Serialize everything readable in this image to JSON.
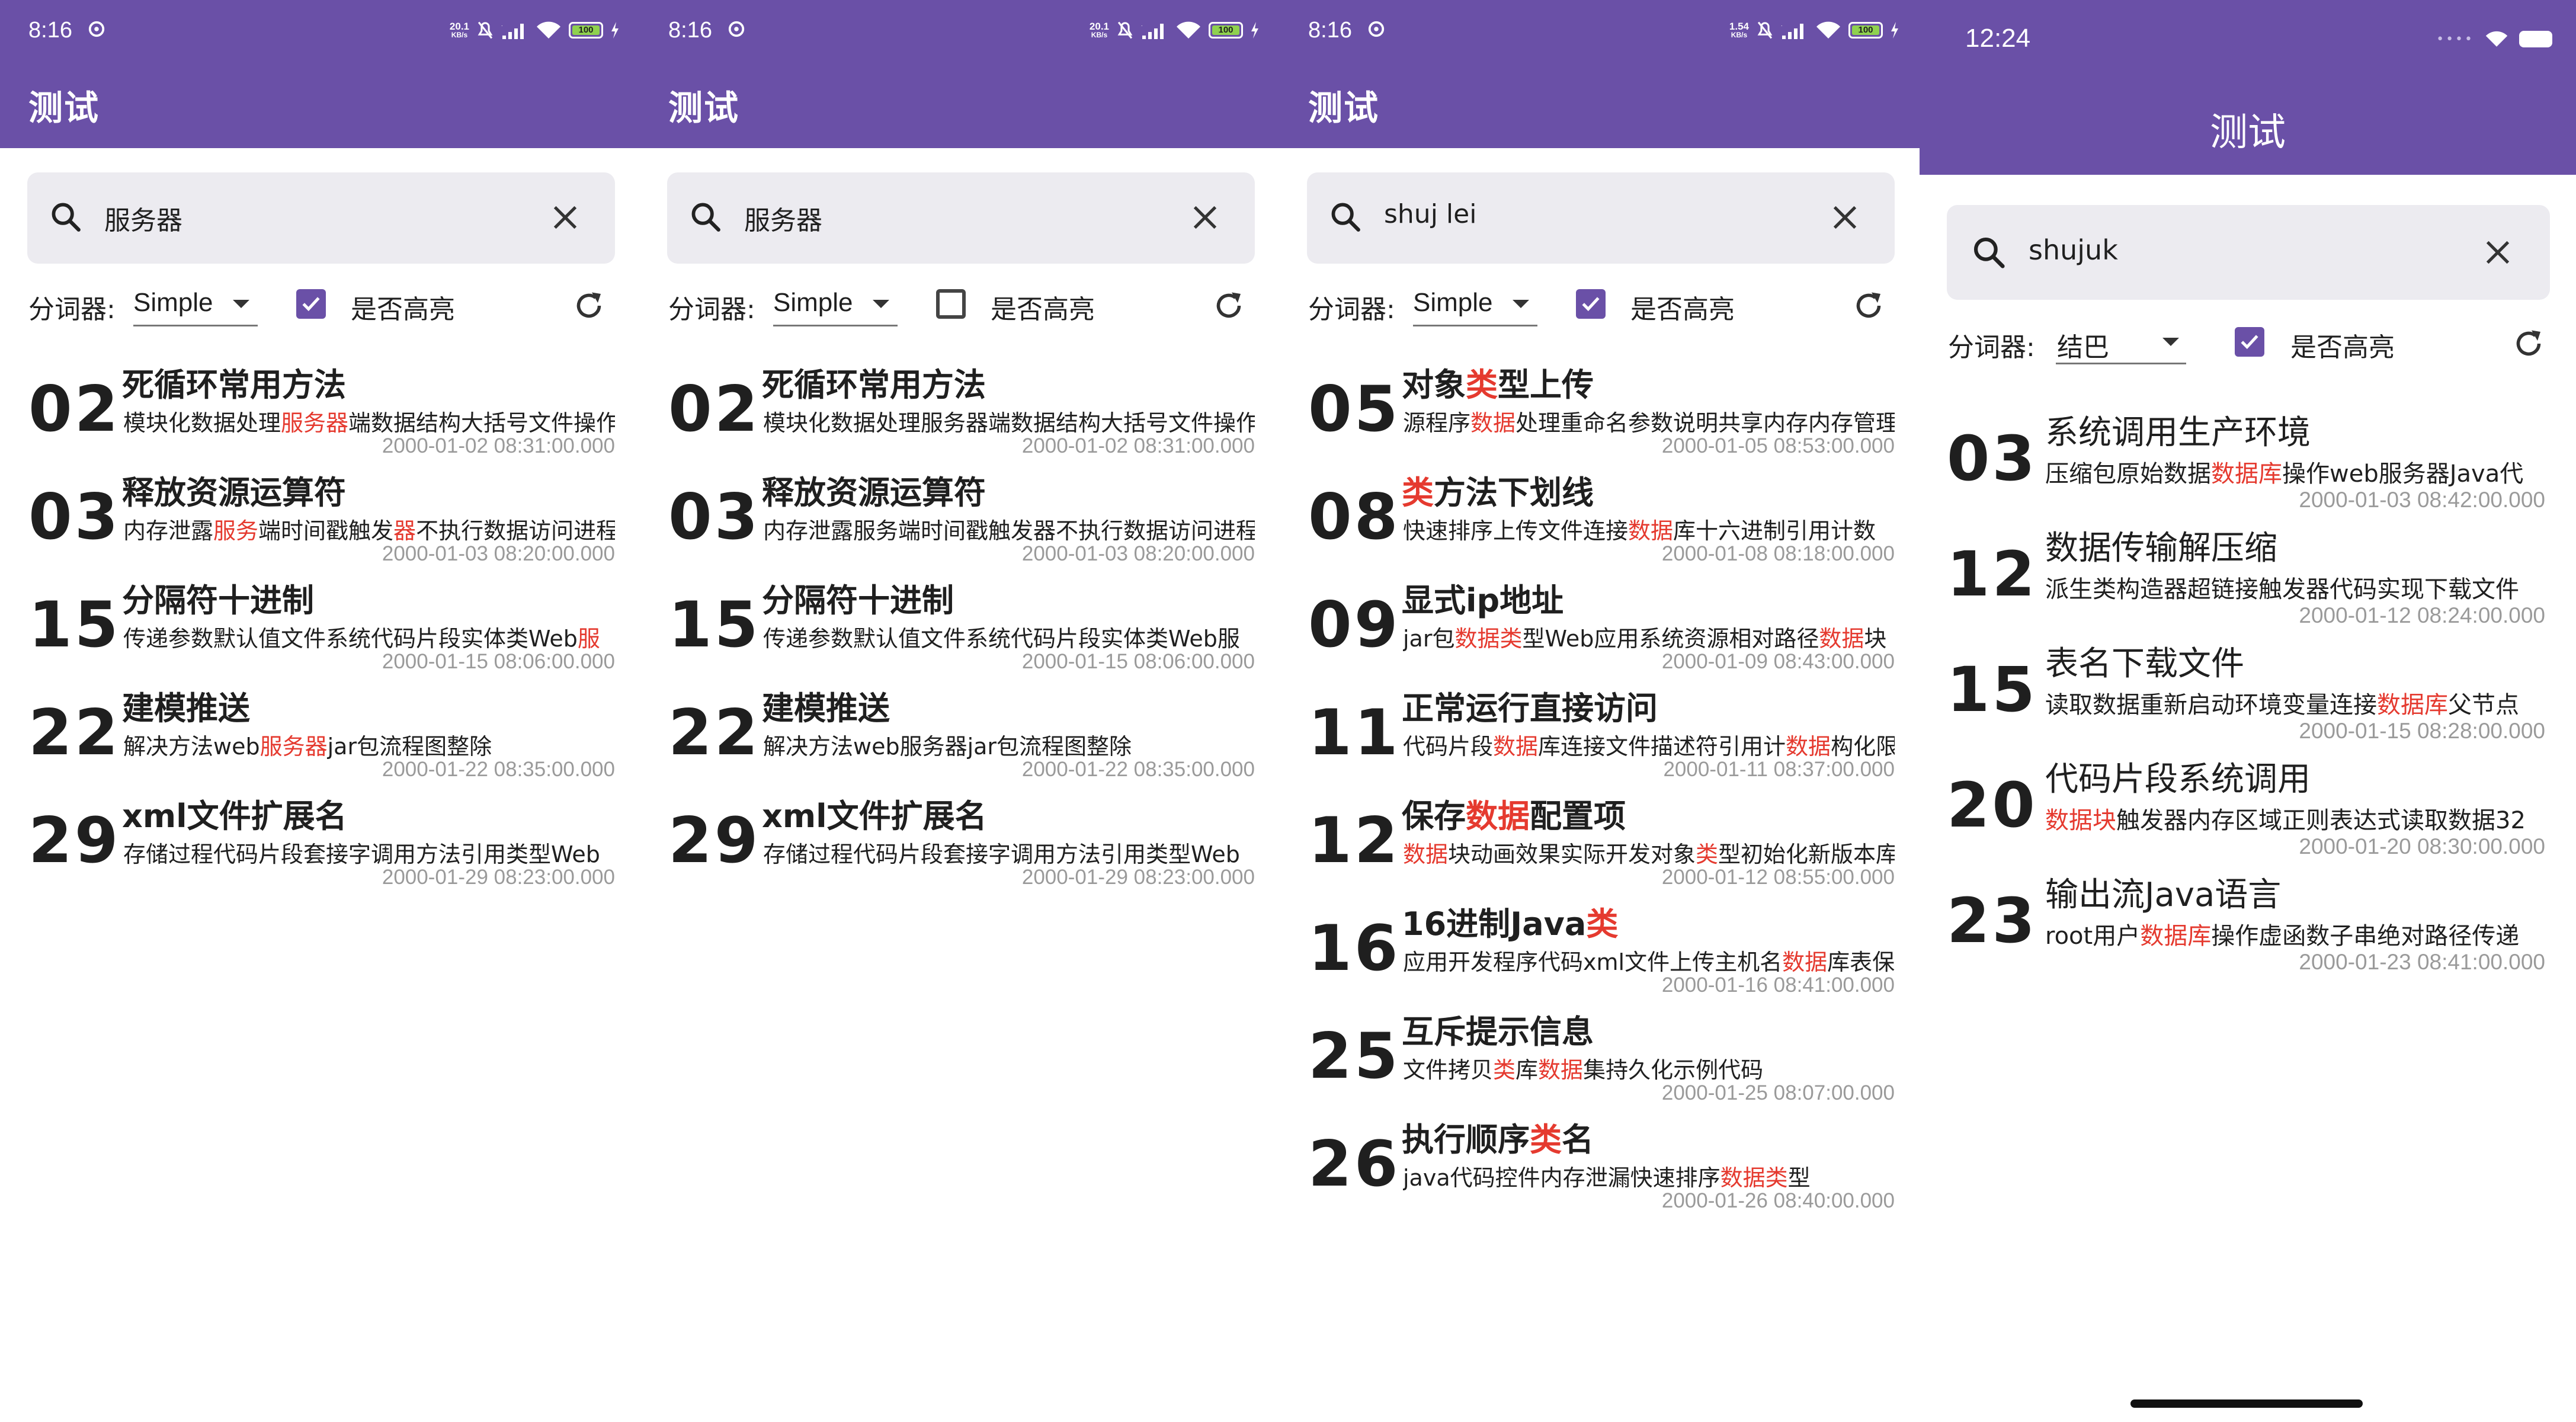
{
  "screens": [
    {
      "status": {
        "time": "8:16",
        "speed": "20.1",
        "speed_unit": "KB/s",
        "battery": "100"
      },
      "title": "测试",
      "search": {
        "value": "服务器"
      },
      "tokenizer_label": "分词器:",
      "tokenizer_value": "Simple",
      "highlight_label": "是否高亮",
      "highlight_checked": true,
      "items": [
        {
          "num": "02",
          "title": [
            {
              "t": "死循环常用方法"
            }
          ],
          "desc": [
            {
              "t": "模块化数据处理"
            },
            {
              "t": "服务器",
              "h": true
            },
            {
              "t": "端数据结构大括号文件操作"
            }
          ],
          "date": "2000-01-02 08:31:00.000"
        },
        {
          "num": "03",
          "title": [
            {
              "t": "释放资源运算符"
            }
          ],
          "desc": [
            {
              "t": "内存泄露"
            },
            {
              "t": "服务",
              "h": true
            },
            {
              "t": "端时间戳触发"
            },
            {
              "t": "器",
              "h": true
            },
            {
              "t": "不执行数据访问进程"
            }
          ],
          "date": "2000-01-03 08:20:00.000"
        },
        {
          "num": "15",
          "title": [
            {
              "t": "分隔符十进制"
            }
          ],
          "desc": [
            {
              "t": "传递参数默认值文件系统代码片段实体类Web"
            },
            {
              "t": "服",
              "h": true
            }
          ],
          "date": "2000-01-15 08:06:00.000"
        },
        {
          "num": "22",
          "title": [
            {
              "t": "建模推送"
            }
          ],
          "desc": [
            {
              "t": "解决方法web"
            },
            {
              "t": "服务器",
              "h": true
            },
            {
              "t": "jar包流程图整除"
            }
          ],
          "date": "2000-01-22 08:35:00.000"
        },
        {
          "num": "29",
          "title": [
            {
              "t": "xml文件扩展名"
            }
          ],
          "desc": [
            {
              "t": "存储过程代码片段套接字调用方法引用类型Web"
            }
          ],
          "date": "2000-01-29 08:23:00.000"
        }
      ]
    },
    {
      "status": {
        "time": "8:16",
        "speed": "20.1",
        "speed_unit": "KB/s",
        "battery": "100"
      },
      "title": "测试",
      "search": {
        "value": "服务器"
      },
      "tokenizer_label": "分词器:",
      "tokenizer_value": "Simple",
      "highlight_label": "是否高亮",
      "highlight_checked": false,
      "items": [
        {
          "num": "02",
          "title": [
            {
              "t": "死循环常用方法"
            }
          ],
          "desc": [
            {
              "t": "模块化数据处理服务器端数据结构大括号文件操作"
            }
          ],
          "date": "2000-01-02 08:31:00.000"
        },
        {
          "num": "03",
          "title": [
            {
              "t": "释放资源运算符"
            }
          ],
          "desc": [
            {
              "t": "内存泄露服务端时间戳触发器不执行数据访问进程"
            }
          ],
          "date": "2000-01-03 08:20:00.000"
        },
        {
          "num": "15",
          "title": [
            {
              "t": "分隔符十进制"
            }
          ],
          "desc": [
            {
              "t": "传递参数默认值文件系统代码片段实体类Web服"
            }
          ],
          "date": "2000-01-15 08:06:00.000"
        },
        {
          "num": "22",
          "title": [
            {
              "t": "建模推送"
            }
          ],
          "desc": [
            {
              "t": "解决方法web服务器jar包流程图整除"
            }
          ],
          "date": "2000-01-22 08:35:00.000"
        },
        {
          "num": "29",
          "title": [
            {
              "t": "xml文件扩展名"
            }
          ],
          "desc": [
            {
              "t": "存储过程代码片段套接字调用方法引用类型Web"
            }
          ],
          "date": "2000-01-29 08:23:00.000"
        }
      ]
    },
    {
      "status": {
        "time": "8:16",
        "speed": "1.54",
        "speed_unit": "KB/s",
        "battery": "100"
      },
      "title": "测试",
      "search": {
        "value": "shuj lei"
      },
      "tokenizer_label": "分词器:",
      "tokenizer_value": "Simple",
      "highlight_label": "是否高亮",
      "highlight_checked": true,
      "items": [
        {
          "num": "05",
          "title": [
            {
              "t": "对象"
            },
            {
              "t": "类",
              "h": true
            },
            {
              "t": "型上传"
            }
          ],
          "desc": [
            {
              "t": "源程序"
            },
            {
              "t": "数据",
              "h": true
            },
            {
              "t": "处理重命名参数说明共享内存内存管理"
            }
          ],
          "date": "2000-01-05 08:53:00.000"
        },
        {
          "num": "08",
          "title": [
            {
              "t": "类",
              "h": true
            },
            {
              "t": "方法下划线"
            }
          ],
          "desc": [
            {
              "t": "快速排序上传文件连接"
            },
            {
              "t": "数据",
              "h": true
            },
            {
              "t": "库十六进制引用计数"
            }
          ],
          "date": "2000-01-08 08:18:00.000"
        },
        {
          "num": "09",
          "title": [
            {
              "t": "显式ip地址"
            }
          ],
          "desc": [
            {
              "t": "jar包"
            },
            {
              "t": "数据类",
              "h": true
            },
            {
              "t": "型Web应用系统资源相对路径"
            },
            {
              "t": "数据",
              "h": true
            },
            {
              "t": "块"
            }
          ],
          "date": "2000-01-09 08:43:00.000"
        },
        {
          "num": "11",
          "title": [
            {
              "t": "正常运行直接访问"
            }
          ],
          "desc": [
            {
              "t": "代码片段"
            },
            {
              "t": "数据",
              "h": true
            },
            {
              "t": "库连接文件描述符引用计"
            },
            {
              "t": "数据",
              "h": true
            },
            {
              "t": "构化限"
            }
          ],
          "date": "2000-01-11 08:37:00.000"
        },
        {
          "num": "12",
          "title": [
            {
              "t": "保存"
            },
            {
              "t": "数据",
              "h": true
            },
            {
              "t": "配置项"
            }
          ],
          "desc": [
            {
              "t": "数据",
              "h": true
            },
            {
              "t": "块动画效果实际开发对象"
            },
            {
              "t": "类",
              "h": true
            },
            {
              "t": "型初始化新版本库"
            }
          ],
          "date": "2000-01-12 08:55:00.000"
        },
        {
          "num": "16",
          "title": [
            {
              "t": "16进制Java"
            },
            {
              "t": "类",
              "h": true
            }
          ],
          "desc": [
            {
              "t": "应用开发程序代码xml文件上传主机名"
            },
            {
              "t": "数据",
              "h": true
            },
            {
              "t": "库表保存"
            }
          ],
          "date": "2000-01-16 08:41:00.000"
        },
        {
          "num": "25",
          "title": [
            {
              "t": "互斥提示信息"
            }
          ],
          "desc": [
            {
              "t": "文件拷贝"
            },
            {
              "t": "类",
              "h": true
            },
            {
              "t": "库"
            },
            {
              "t": "数据",
              "h": true
            },
            {
              "t": "集持久化示例代码"
            }
          ],
          "date": "2000-01-25 08:07:00.000"
        },
        {
          "num": "26",
          "title": [
            {
              "t": "执行顺序"
            },
            {
              "t": "类",
              "h": true
            },
            {
              "t": "名"
            }
          ],
          "desc": [
            {
              "t": "java代码控件内存泄漏快速排序"
            },
            {
              "t": "数据类",
              "h": true
            },
            {
              "t": "型"
            }
          ],
          "date": "2000-01-26 08:40:00.000"
        }
      ]
    },
    {
      "status": {
        "time": "12:24"
      },
      "title": "测试",
      "search": {
        "value": "shujuk"
      },
      "tokenizer_label": "分词器:",
      "tokenizer_value": "结巴",
      "highlight_label": "是否高亮",
      "highlight_checked": true,
      "items": [
        {
          "num": "03",
          "title": [
            {
              "t": "系统调用生产环境"
            }
          ],
          "desc": [
            {
              "t": "压缩包原始数据"
            },
            {
              "t": "数据库",
              "h": true
            },
            {
              "t": "操作web服务器Java代"
            }
          ],
          "date": "2000-01-03 08:42:00.000"
        },
        {
          "num": "12",
          "title": [
            {
              "t": "数据传输解压缩"
            }
          ],
          "desc": [
            {
              "t": "派生类构造器超链接触发器代码实现下载文件"
            }
          ],
          "date": "2000-01-12 08:24:00.000"
        },
        {
          "num": "15",
          "title": [
            {
              "t": "表名下载文件"
            }
          ],
          "desc": [
            {
              "t": "读取数据重新启动环境变量连接"
            },
            {
              "t": "数据库",
              "h": true
            },
            {
              "t": "父节点"
            }
          ],
          "date": "2000-01-15 08:28:00.000"
        },
        {
          "num": "20",
          "title": [
            {
              "t": "代码片段系统调用"
            }
          ],
          "desc": [
            {
              "t": "数据块",
              "h": true
            },
            {
              "t": "触发器内存区域正则表达式读取数据32"
            }
          ],
          "date": "2000-01-20 08:30:00.000"
        },
        {
          "num": "23",
          "title": [
            {
              "t": "输出流Java语言"
            }
          ],
          "desc": [
            {
              "t": "root用户"
            },
            {
              "t": "数据库",
              "h": true
            },
            {
              "t": "操作虚函数子串绝对路径传递"
            }
          ],
          "date": "2000-01-23 08:41:00.000"
        }
      ]
    }
  ],
  "colors": {
    "appbar": "#6a50a7",
    "highlight": "#e53a2f",
    "search_bg": "#ecebf0",
    "date": "#9a9a9a"
  },
  "icons": [
    "search-icon",
    "close-icon",
    "chevron-down-icon",
    "checkbox-icon",
    "refresh-icon",
    "wifi-icon",
    "signal-icon",
    "battery-icon"
  ]
}
